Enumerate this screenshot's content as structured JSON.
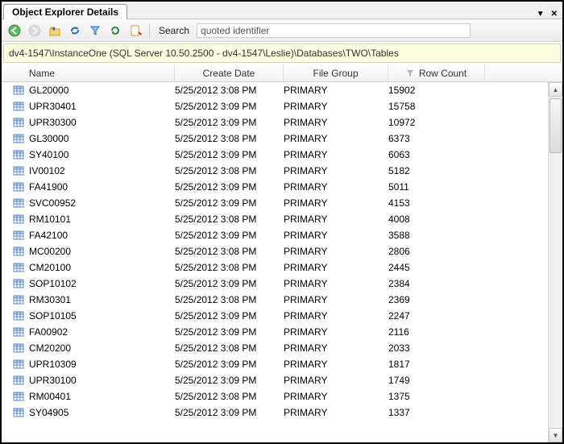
{
  "title": {
    "tab": "Object Explorer Details"
  },
  "toolbar": {
    "search_label": "Search",
    "search_value": "quoted identifier"
  },
  "path": "dv4-1547\\InstanceOne (SQL Server 10.50.2500 - dv4-1547\\Leslie)\\Databases\\TWO\\Tables",
  "columns": {
    "name": "Name",
    "create_date": "Create Date",
    "file_group": "File Group",
    "row_count": "Row Count"
  },
  "rows": [
    {
      "name": "GL20000",
      "date": "5/25/2012 3:08 PM",
      "fg": "PRIMARY",
      "count": "15902"
    },
    {
      "name": "UPR30401",
      "date": "5/25/2012 3:09 PM",
      "fg": "PRIMARY",
      "count": "15758"
    },
    {
      "name": "UPR30300",
      "date": "5/25/2012 3:09 PM",
      "fg": "PRIMARY",
      "count": "10972"
    },
    {
      "name": "GL30000",
      "date": "5/25/2012 3:08 PM",
      "fg": "PRIMARY",
      "count": "6373"
    },
    {
      "name": "SY40100",
      "date": "5/25/2012 3:09 PM",
      "fg": "PRIMARY",
      "count": "6063"
    },
    {
      "name": "IV00102",
      "date": "5/25/2012 3:08 PM",
      "fg": "PRIMARY",
      "count": "5182"
    },
    {
      "name": "FA41900",
      "date": "5/25/2012 3:09 PM",
      "fg": "PRIMARY",
      "count": "5011"
    },
    {
      "name": "SVC00952",
      "date": "5/25/2012 3:09 PM",
      "fg": "PRIMARY",
      "count": "4153"
    },
    {
      "name": "RM10101",
      "date": "5/25/2012 3:08 PM",
      "fg": "PRIMARY",
      "count": "4008"
    },
    {
      "name": "FA42100",
      "date": "5/25/2012 3:09 PM",
      "fg": "PRIMARY",
      "count": "3588"
    },
    {
      "name": "MC00200",
      "date": "5/25/2012 3:08 PM",
      "fg": "PRIMARY",
      "count": "2806"
    },
    {
      "name": "CM20100",
      "date": "5/25/2012 3:08 PM",
      "fg": "PRIMARY",
      "count": "2445"
    },
    {
      "name": "SOP10102",
      "date": "5/25/2012 3:09 PM",
      "fg": "PRIMARY",
      "count": "2384"
    },
    {
      "name": "RM30301",
      "date": "5/25/2012 3:08 PM",
      "fg": "PRIMARY",
      "count": "2369"
    },
    {
      "name": "SOP10105",
      "date": "5/25/2012 3:09 PM",
      "fg": "PRIMARY",
      "count": "2247"
    },
    {
      "name": "FA00902",
      "date": "5/25/2012 3:09 PM",
      "fg": "PRIMARY",
      "count": "2116"
    },
    {
      "name": "CM20200",
      "date": "5/25/2012 3:08 PM",
      "fg": "PRIMARY",
      "count": "2033"
    },
    {
      "name": "UPR10309",
      "date": "5/25/2012 3:09 PM",
      "fg": "PRIMARY",
      "count": "1817"
    },
    {
      "name": "UPR30100",
      "date": "5/25/2012 3:09 PM",
      "fg": "PRIMARY",
      "count": "1749"
    },
    {
      "name": "RM00401",
      "date": "5/25/2012 3:08 PM",
      "fg": "PRIMARY",
      "count": "1375"
    },
    {
      "name": "SY04905",
      "date": "5/25/2012 3:09 PM",
      "fg": "PRIMARY",
      "count": "1337"
    }
  ]
}
